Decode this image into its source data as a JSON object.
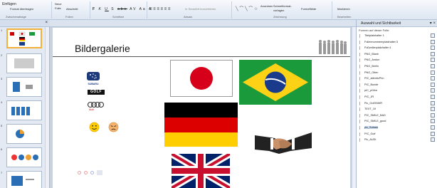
{
  "ribbon": {
    "paste": "Einfügen",
    "format_painter": "Format übertragen",
    "clipboard_group": "Zwischenablage",
    "new_slide": "Neue Folie",
    "section": "Abschnitt",
    "slides_group": "Folien",
    "font_group": "Schriftart",
    "font_buttons": [
      "F",
      "K",
      "U",
      "S",
      "abc",
      "AV",
      "Aa",
      "A"
    ],
    "paragraph_group": "Absatz",
    "smartart": "In SmartArt konvertieren",
    "drawing_group": "Zeichnung",
    "arrange": "Anordnen",
    "quick_styles": "Schnellformat-vorlagen",
    "shape_fill": "Formeffekte",
    "editing_group": "Bearbeiten",
    "select": "Markieren"
  },
  "thumbnails": [
    "1",
    "2",
    "3",
    "4",
    "5",
    "6",
    "7"
  ],
  "slide": {
    "title": "Bildergalerie",
    "logos": [
      "SUBARU",
      "GOLF",
      "Audi"
    ]
  },
  "pane": {
    "title": "Auswahl und Sichtbarkeit",
    "subtitle": "Formen auf dieser Folie:",
    "objects": [
      "Titelplatzhalter 1",
      "Foliennummernplatzhalter 5",
      "Fußzeilenplatzhalter 4",
      "PNG_Blank",
      "PNG_Andon",
      "PNG_Berlin",
      "PNG_Olten",
      "PIC_attentivPhn",
      "PIC_Bunde",
      "pIC_pGrlw",
      "PIC_JR",
      "Pic_GoEINWR",
      "TEXT_19",
      "PIC_SMILE_BAD",
      "PIC_SMILE_good",
      "pic_Subaru",
      "PIC_Golf",
      "Pic_AUDI"
    ],
    "selected_index": 15
  }
}
